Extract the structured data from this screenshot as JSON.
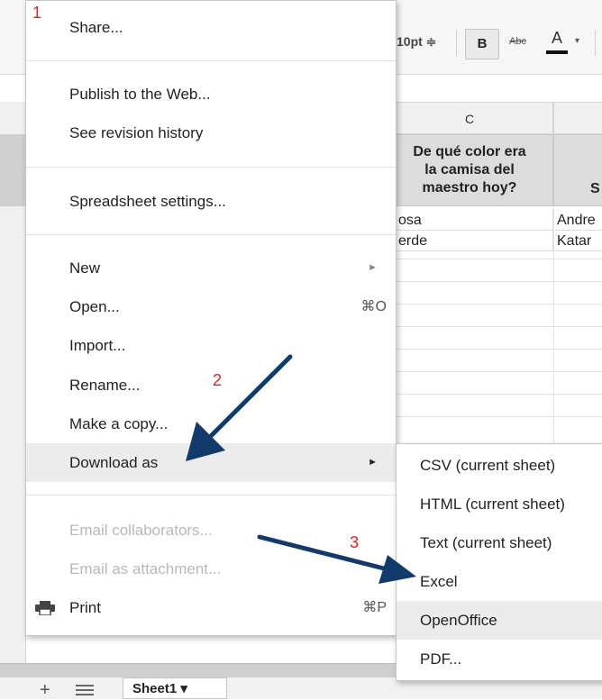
{
  "toolbar": {
    "font_size": "10pt ≑",
    "bold_label": "B",
    "strike_label": "Abc",
    "text_color_label": "A",
    "dropdown_glyph": "▾"
  },
  "spreadsheet": {
    "column_c_header": "C",
    "question_lines": [
      "De qué color era",
      "la camisa del",
      "maestro hoy?"
    ],
    "partial_header_d": "S",
    "rows": [
      {
        "c": "osa",
        "d": "Andre"
      },
      {
        "c": "erde",
        "d": "Katar"
      }
    ]
  },
  "file_menu": {
    "share": "Share...",
    "publish": "Publish to the Web...",
    "revision_history": "See revision history",
    "spreadsheet_settings": "Spreadsheet settings...",
    "new": "New",
    "open": "Open...",
    "open_shortcut": "⌘O",
    "import": "Import...",
    "rename": "Rename...",
    "make_copy": "Make a copy...",
    "download_as": "Download as",
    "email_collaborators": "Email collaborators...",
    "email_attachment": "Email as attachment...",
    "print": "Print",
    "print_shortcut": "⌘P",
    "submenu_arrow": "►"
  },
  "download_submenu": {
    "items": [
      "CSV (current sheet)",
      "HTML (current sheet)",
      "Text (current sheet)",
      "Excel",
      "OpenOffice",
      "PDF..."
    ]
  },
  "sheet_tabs": {
    "add_glyph": "+",
    "active_tab": "Sheet1 ▾"
  },
  "annotations": {
    "step1": "1",
    "step2": "2",
    "step3": "3"
  },
  "colors": {
    "arrow": "#123a6b",
    "step_number": "#e02020",
    "highlight": "#ececec"
  }
}
